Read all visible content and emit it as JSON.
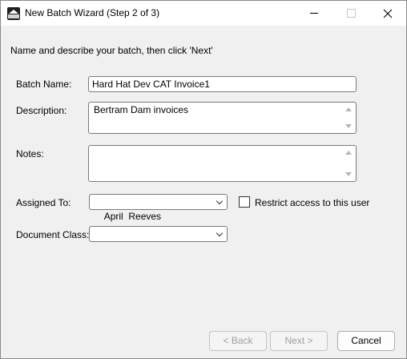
{
  "window": {
    "title": "New Batch Wizard (Step 2 of 3)"
  },
  "icons": {
    "app": "app-icon",
    "minimize": "minimize-icon",
    "maximize": "maximize-icon",
    "close": "close-icon"
  },
  "instructions": "Name and describe your batch, then click 'Next'",
  "form": {
    "batch_name_label": "Batch Name:",
    "batch_name_value": "Hard Hat Dev CAT Invoice1",
    "description_label": "Description:",
    "description_value": "Bertram Dam invoices",
    "notes_label": "Notes:",
    "notes_value": "",
    "assigned_to_label": "Assigned To:",
    "assigned_to_value": "April  Reeves",
    "restrict_label": "Restrict access to this user",
    "restrict_checked": false,
    "document_class_label": "Document Class:",
    "document_class_value": ""
  },
  "buttons": {
    "back": "< Back",
    "next": "Next >",
    "cancel": "Cancel"
  }
}
